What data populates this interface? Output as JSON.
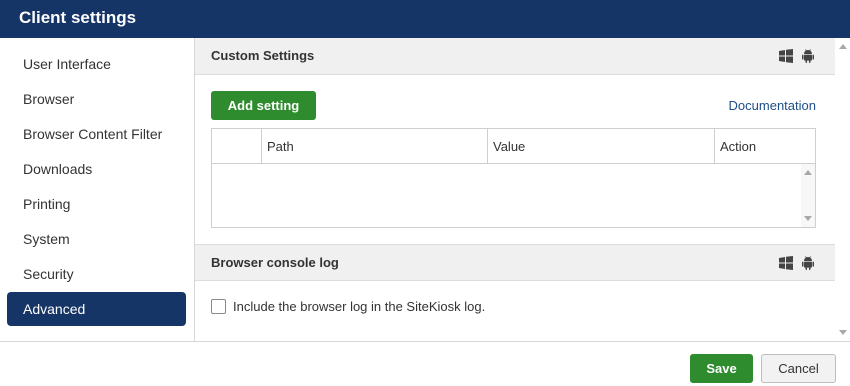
{
  "window": {
    "title": "Client settings"
  },
  "sidebar": {
    "items": [
      {
        "label": "User Interface",
        "active": false
      },
      {
        "label": "Browser",
        "active": false
      },
      {
        "label": "Browser Content Filter",
        "active": false
      },
      {
        "label": "Downloads",
        "active": false
      },
      {
        "label": "Printing",
        "active": false
      },
      {
        "label": "System",
        "active": false
      },
      {
        "label": "Security",
        "active": false
      },
      {
        "label": "Advanced",
        "active": true
      }
    ]
  },
  "custom_settings": {
    "title": "Custom Settings",
    "add_button": "Add setting",
    "documentation_link": "Documentation",
    "table": {
      "columns": [
        "",
        "Path",
        "Value",
        "Action"
      ],
      "rows": []
    },
    "platform_icons": [
      "windows-icon",
      "android-icon"
    ]
  },
  "console_log": {
    "title": "Browser console log",
    "checkbox_label": "Include the browser log in the SiteKiosk log.",
    "checked": false,
    "platform_icons": [
      "windows-icon",
      "android-icon"
    ]
  },
  "footer": {
    "save_label": "Save",
    "cancel_label": "Cancel"
  },
  "colors": {
    "brand_navy": "#163567",
    "action_green": "#2e8b2e",
    "link_blue": "#1f4f8a"
  }
}
